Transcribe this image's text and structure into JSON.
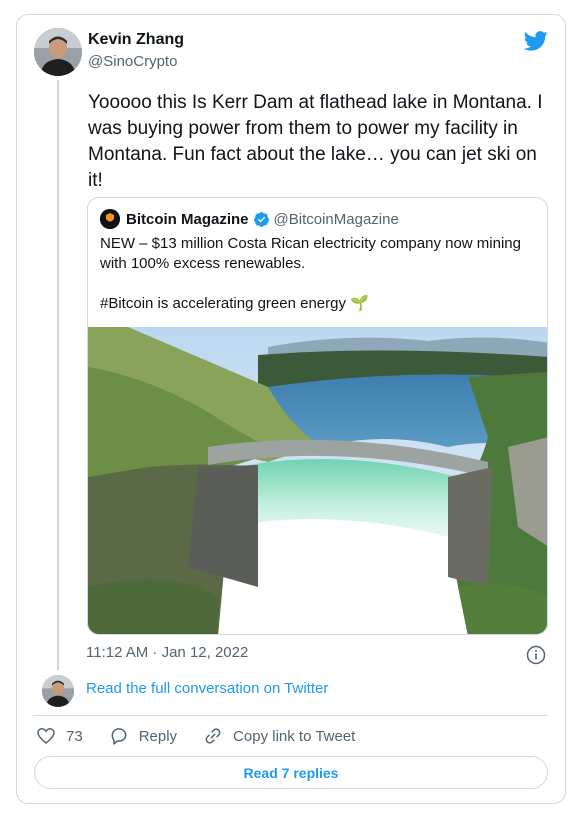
{
  "author": {
    "name": "Kevin Zhang",
    "handle": "@SinoCrypto",
    "avatar_icon": "user-avatar"
  },
  "tweet": {
    "text": "Yooooo this Is Kerr Dam at flathead lake in Montana. I was buying power from them to power my facility in Montana. Fun fact about the lake… you can jet ski on it!",
    "timestamp": "11:12 AM · Jan 12, 2022"
  },
  "quoted_tweet": {
    "name": "Bitcoin Magazine",
    "handle": "@BitcoinMagazine",
    "verified": true,
    "line1": "NEW – $13 million Costa Rican electricity company now mining with 100% excess renewables.",
    "line2": "#Bitcoin is accelerating green energy 🌱",
    "image_icon": "dam-photo"
  },
  "links": {
    "read_conversation": "Read the full conversation on Twitter",
    "read_replies": "Read 7 replies"
  },
  "actions": {
    "like_count": "73",
    "reply_label": "Reply",
    "copy_link_label": "Copy link to Tweet"
  },
  "colors": {
    "accent": "#1d9bf0",
    "text": "#0f1419",
    "muted": "#536471",
    "border": "#cfd9de"
  }
}
